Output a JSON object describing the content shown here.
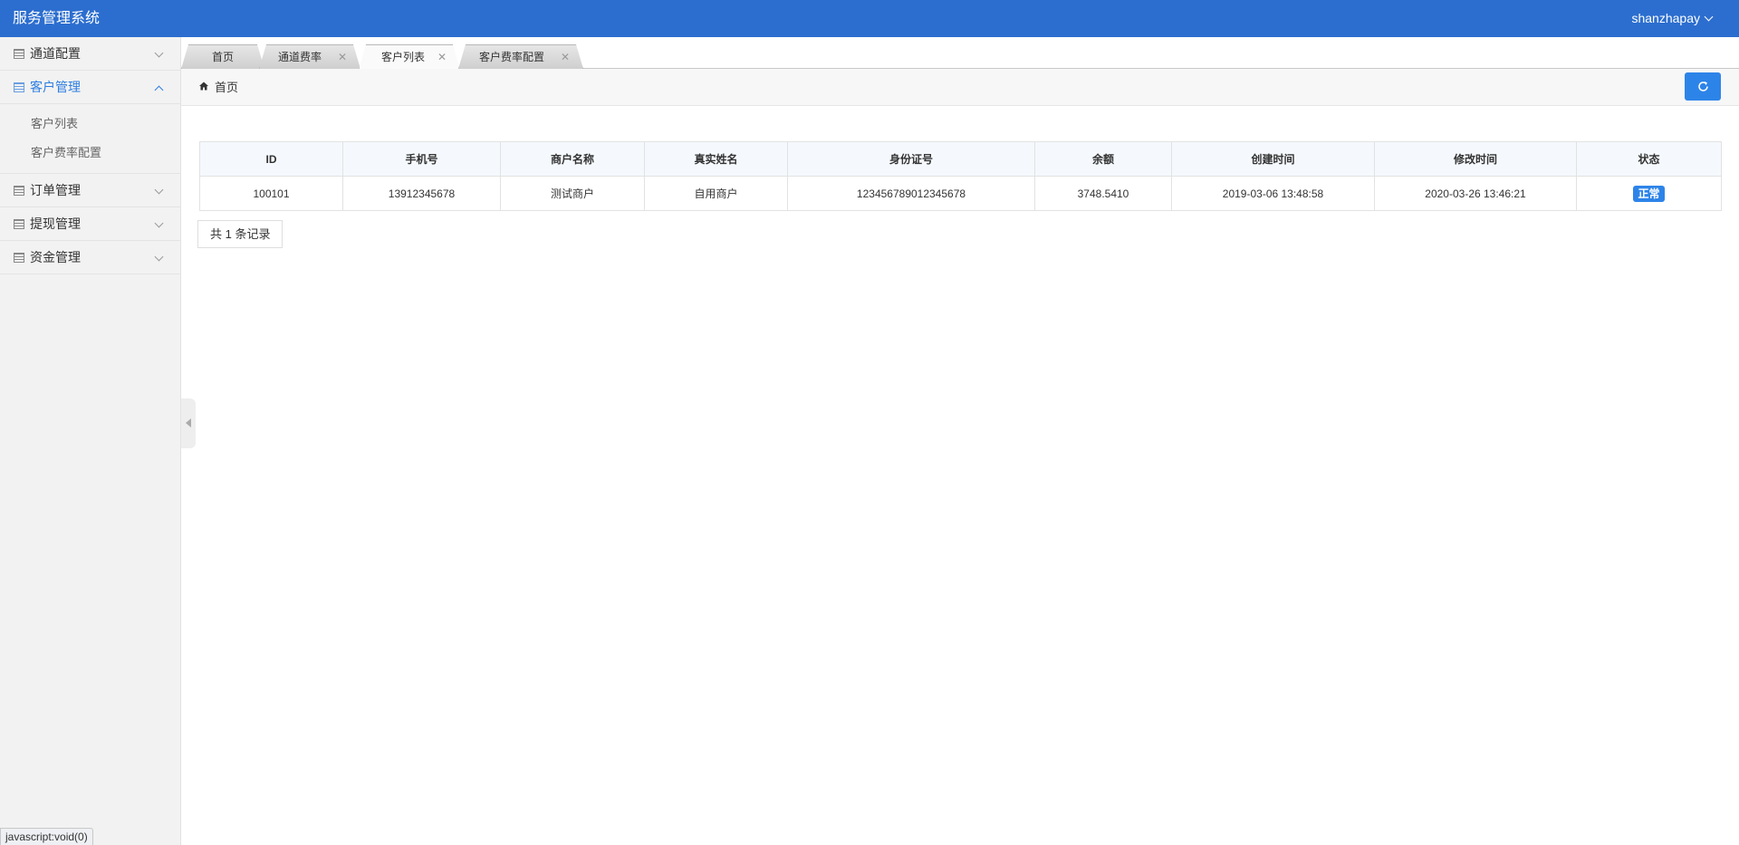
{
  "header": {
    "title": "服务管理系统",
    "user": "shanzhapay"
  },
  "sidebar": {
    "items": [
      {
        "label": "通道配置",
        "expanded": false
      },
      {
        "label": "客户管理",
        "expanded": true,
        "children": [
          "客户列表",
          "客户费率配置"
        ]
      },
      {
        "label": "订单管理",
        "expanded": false
      },
      {
        "label": "提现管理",
        "expanded": false
      },
      {
        "label": "资金管理",
        "expanded": false
      }
    ]
  },
  "tabs": [
    {
      "label": "首页",
      "closable": false
    },
    {
      "label": "通道费率",
      "closable": true
    },
    {
      "label": "客户列表",
      "closable": true,
      "active": true
    },
    {
      "label": "客户费率配置",
      "closable": true
    }
  ],
  "breadcrumb": "首页",
  "table": {
    "columns": [
      "ID",
      "手机号",
      "商户名称",
      "真实姓名",
      "身份证号",
      "余额",
      "创建时间",
      "修改时间",
      "状态"
    ],
    "rows": [
      {
        "id": "100101",
        "phone": "13912345678",
        "merchant": "测试商户",
        "real_name": "自用商户",
        "id_card": "123456789012345678",
        "balance": "3748.5410",
        "created": "2019-03-06 13:48:58",
        "modified": "2020-03-26 13:46:21",
        "status": "正常"
      }
    ]
  },
  "records_text": "共 1 条记录",
  "statusbar": "javascript:void(0)",
  "colors": {
    "header": "#2c6ecf",
    "accent": "#2d84e8",
    "active_menu": "#2d7ee0"
  }
}
